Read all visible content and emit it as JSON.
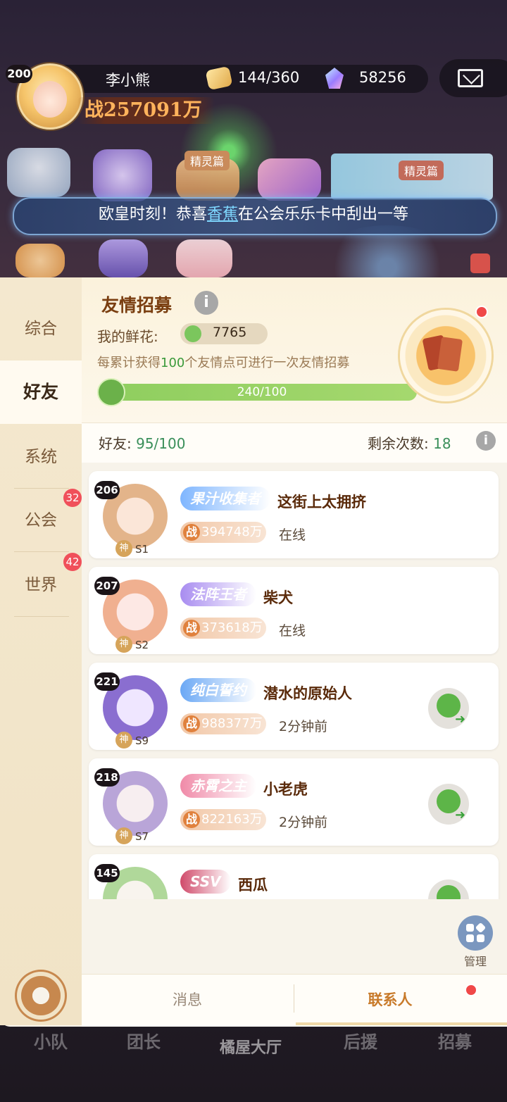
{
  "player": {
    "level": "200",
    "name": "李小熊",
    "stamina": "144/360",
    "gems": "58256",
    "power": "战257091万"
  },
  "banner_tags": {
    "left": "精灵篇",
    "right": "精灵篇"
  },
  "marquee": {
    "before": "欧皇时刻！恭喜",
    "highlight": "香蕉",
    "after": "在公会乐乐卡中刮出一等"
  },
  "sidebar": {
    "items": [
      {
        "label": "综合",
        "badge": ""
      },
      {
        "label": "好友",
        "badge": ""
      },
      {
        "label": "系统",
        "badge": ""
      },
      {
        "label": "公会",
        "badge": "32"
      },
      {
        "label": "世界",
        "badge": "42"
      }
    ]
  },
  "recruit": {
    "title": "友情招募",
    "flowers_label": "我的鲜花:",
    "flowers_value": "7765",
    "desc_prefix": "每累计获得",
    "desc_num": "100",
    "desc_suffix": "个友情点可进行一次友情招募",
    "progress_text": "240/100",
    "progress_fraction": 1.0
  },
  "stats": {
    "friends_label": "好友:",
    "friends_value": "95/100",
    "remaining_label": "剩余次数:",
    "remaining_value": "18"
  },
  "friends": [
    {
      "level": "206",
      "title": "果汁收集者",
      "name": "这街上太拥挤",
      "power": "394748万",
      "status": "在线",
      "server": "S1",
      "god": "神",
      "send": false
    },
    {
      "level": "207",
      "title": "法阵王者",
      "name": "柴犬",
      "power": "373618万",
      "status": "在线",
      "server": "S2",
      "god": "神",
      "send": false
    },
    {
      "level": "221",
      "title": "纯白誓约",
      "name": "潜水的原始人",
      "power": "988377万",
      "status": "2分钟前",
      "server": "S9",
      "god": "神",
      "send": true
    },
    {
      "level": "218",
      "title": "赤霄之主",
      "name": "小老虎",
      "power": "822163万",
      "status": "2分钟前",
      "server": "S7",
      "god": "神",
      "send": true
    },
    {
      "level": "145",
      "title": "SSV",
      "name": "西瓜",
      "power": "",
      "status": "",
      "server": "",
      "god": "",
      "send": true
    }
  ],
  "power_prefix": "战",
  "manage_label": "管理",
  "tabs": {
    "messages": "消息",
    "contacts": "联系人"
  },
  "game_nav": [
    "小队",
    "团长",
    "橘屋大厅",
    "后援",
    "招募"
  ]
}
